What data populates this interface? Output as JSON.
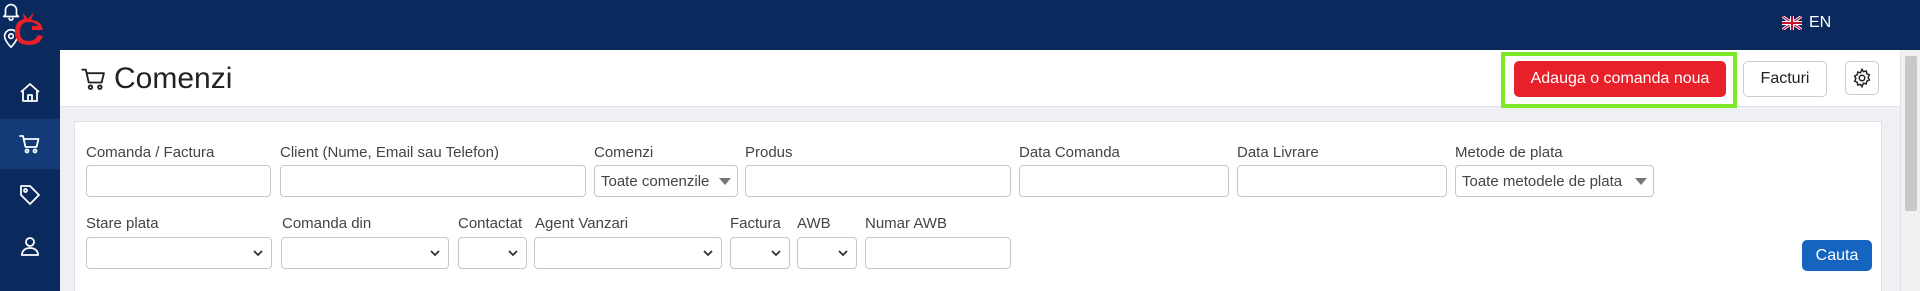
{
  "topbar": {
    "language": "EN",
    "icons": [
      "notification-bell-icon",
      "location-pin-icon",
      "help-icon",
      "uk-flag-icon",
      "logout-icon"
    ]
  },
  "sidebar": {
    "items": [
      {
        "icon": "home-icon"
      },
      {
        "icon": "cart-icon",
        "active": true
      },
      {
        "icon": "tag-icon"
      },
      {
        "icon": "users-icon"
      }
    ]
  },
  "header": {
    "title": "Comenzi",
    "add_button": "Adauga o comanda noua",
    "invoices_button": "Facturi"
  },
  "filters": {
    "order_invoice": {
      "label": "Comanda / Factura",
      "value": ""
    },
    "client": {
      "label": "Client (Nume, Email sau Telefon)",
      "value": ""
    },
    "orders": {
      "label": "Comenzi",
      "selected": "Toate comenzile"
    },
    "product": {
      "label": "Produs",
      "value": ""
    },
    "order_date": {
      "label": "Data Comanda",
      "value": ""
    },
    "delivery_date": {
      "label": "Data Livrare",
      "value": ""
    },
    "payment_methods": {
      "label": "Metode de plata",
      "selected": "Toate metodele de plata"
    },
    "payment_status": {
      "label": "Stare plata",
      "selected": ""
    },
    "order_from": {
      "label": "Comanda din",
      "selected": ""
    },
    "contacted": {
      "label": "Contactat",
      "selected": ""
    },
    "sales_agent": {
      "label": "Agent Vanzari",
      "selected": ""
    },
    "invoice": {
      "label": "Factura",
      "selected": ""
    },
    "awb": {
      "label": "AWB",
      "selected": ""
    },
    "awb_number": {
      "label": "Numar AWB",
      "value": ""
    },
    "search_button": "Cauta"
  },
  "colors": {
    "topbar": "#0a2a5e",
    "primary_red": "#e8202a",
    "primary_blue": "#1565c0",
    "highlight": "#7de72a"
  }
}
